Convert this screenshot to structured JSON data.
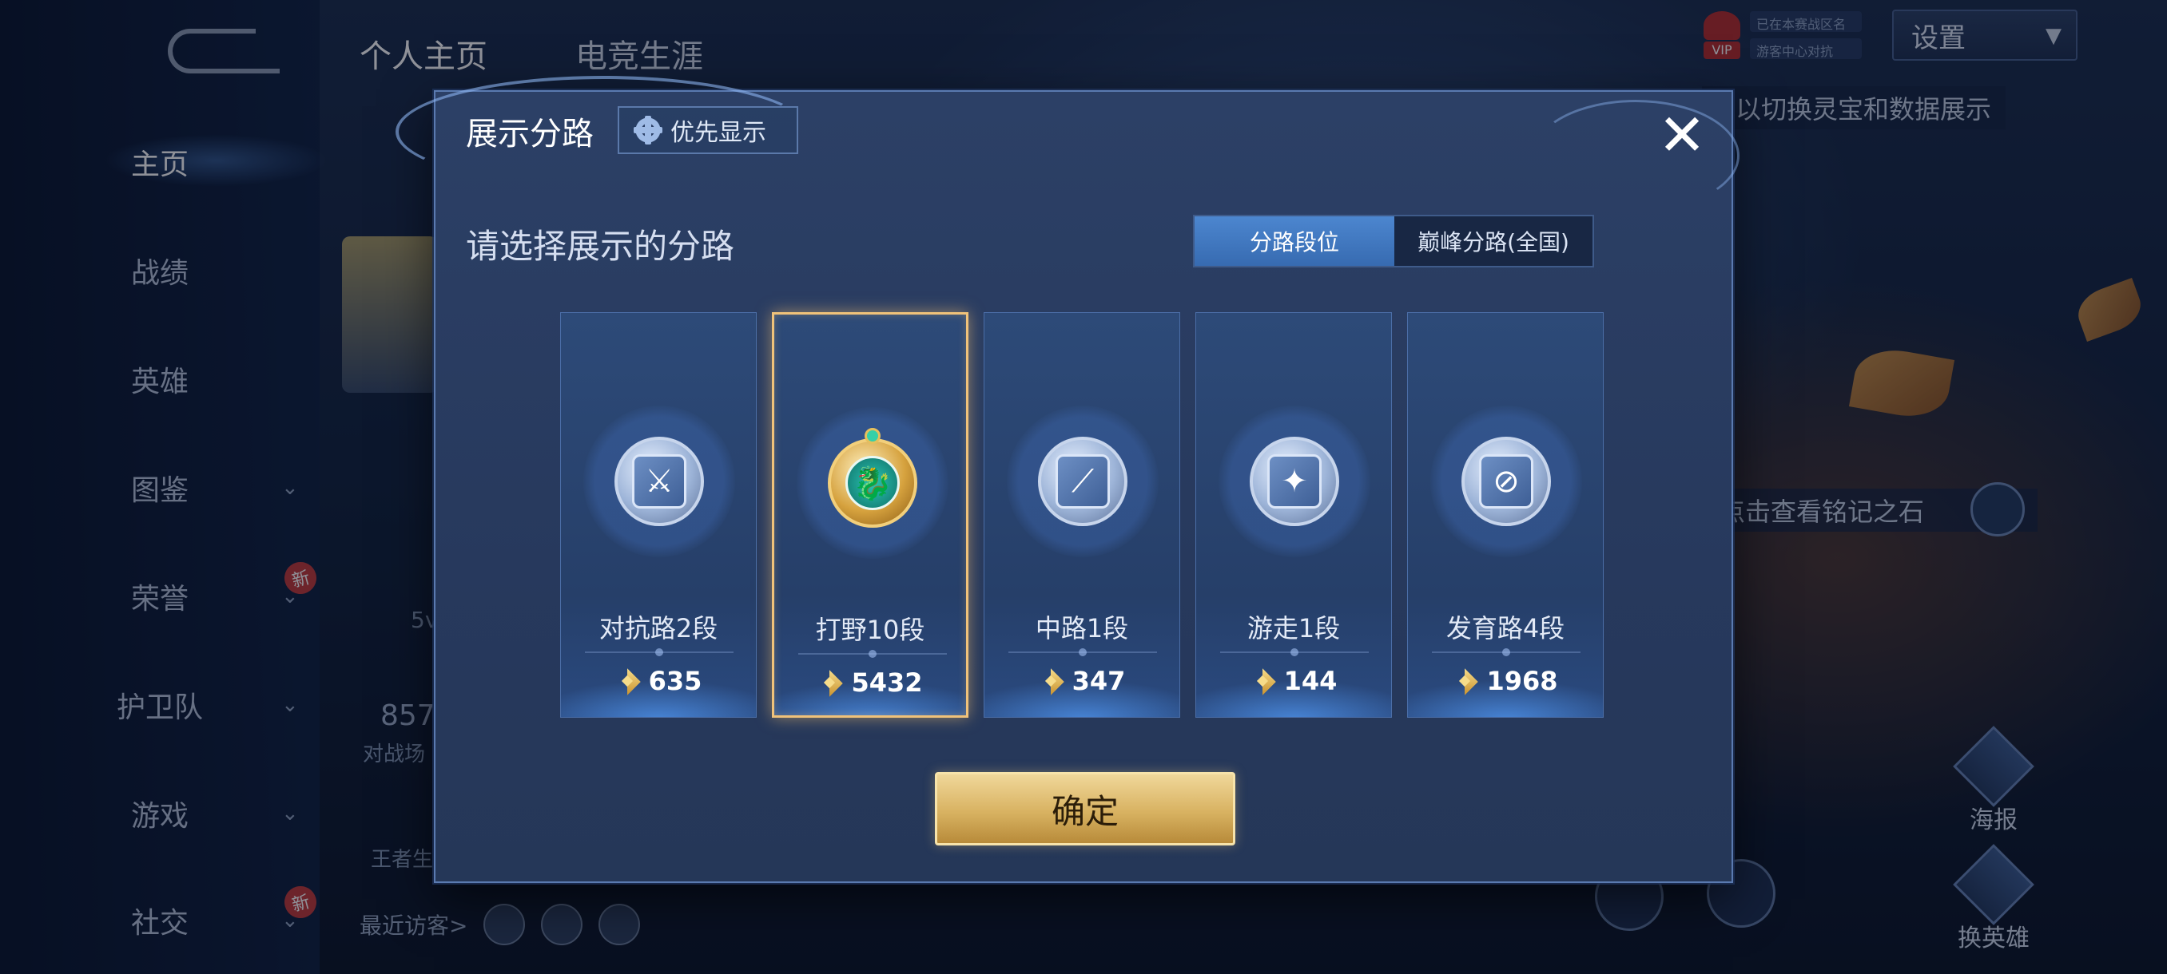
{
  "background": {
    "back_icon": "back-arrow-icon",
    "top_tabs": [
      "个人主页",
      "电竞生涯"
    ],
    "nav": [
      {
        "label": "主页",
        "active": true,
        "chevron": false,
        "badge": ""
      },
      {
        "label": "战绩",
        "active": false,
        "chevron": false,
        "badge": ""
      },
      {
        "label": "英雄",
        "active": false,
        "chevron": false,
        "badge": ""
      },
      {
        "label": "图鉴",
        "active": false,
        "chevron": true,
        "badge": ""
      },
      {
        "label": "荣誉",
        "active": false,
        "chevron": true,
        "badge": "新"
      },
      {
        "label": "护卫队",
        "active": false,
        "chevron": true,
        "badge": ""
      },
      {
        "label": "游戏",
        "active": false,
        "chevron": true,
        "badge": ""
      },
      {
        "label": "社交",
        "active": false,
        "chevron": true,
        "badge": "新"
      }
    ],
    "side_partial": {
      "value_5v": "5v",
      "count": "857",
      "count_label": "对战场",
      "career_label": "王者生"
    },
    "recent_visitors_label": "最近访客>",
    "vip_label": "VIP",
    "notices": [
      "已在本赛战区名",
      "游客中心对抗"
    ],
    "settings_label": "设置",
    "tip_top": "以切换灵宝和数据展示",
    "tip_stone": "点击查看铭记之石",
    "right_buttons": [
      {
        "label": "海报",
        "icon": "poster-icon"
      },
      {
        "label": "换英雄",
        "icon": "swap-hero-icon"
      }
    ]
  },
  "modal": {
    "title": "展示分路",
    "priority_button": "优先显示",
    "priority_icon": "gear-icon",
    "close_icon": "close-icon",
    "subtitle": "请选择展示的分路",
    "tabs": [
      {
        "label": "分路段位",
        "active": true
      },
      {
        "label": "巅峰分路(全国)",
        "active": false
      }
    ],
    "lanes": [
      {
        "rank": "对抗路2段",
        "score": "635",
        "selected": false,
        "emblem": "clash-lane-icon",
        "glyph": "⚔"
      },
      {
        "rank": "打野10段",
        "score": "5432",
        "selected": true,
        "emblem": "jungle-dragon-icon",
        "glyph": "🐉"
      },
      {
        "rank": "中路1段",
        "score": "347",
        "selected": false,
        "emblem": "mid-lane-icon",
        "glyph": "⟋"
      },
      {
        "rank": "游走1段",
        "score": "144",
        "selected": false,
        "emblem": "roam-wings-icon",
        "glyph": "✦"
      },
      {
        "rank": "发育路4段",
        "score": "1968",
        "selected": false,
        "emblem": "farm-lane-icon",
        "glyph": "⊘"
      }
    ],
    "confirm_label": "确定"
  }
}
